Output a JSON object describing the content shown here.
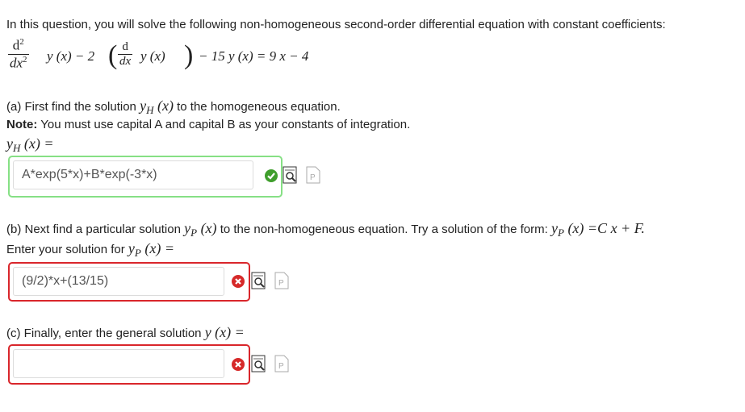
{
  "intro": "In this question, you will solve the following non-homogeneous second-order differential equation with constant coefficients:",
  "equation": {
    "d2": "d",
    "d2sup": "2",
    "dx2": "dx",
    "dx2sup": "2",
    "y1": "y (x) − 2",
    "d": "d",
    "dx": "dx",
    "y2": "y (x)",
    "rest": "− 15 y (x) = 9 x − 4"
  },
  "part_a": {
    "prompt_before": "(a) First find the solution ",
    "prompt_math": "y",
    "prompt_sub": "H",
    "prompt_arg": " (x)",
    "prompt_after": " to the homogeneous equation.",
    "note_label": "Note:",
    "note_text": " You must use capital A and capital B as your constants of integration.",
    "answer_label_y": "y",
    "answer_label_sub": "H",
    "answer_label_rest": " (x) =",
    "value": "A*exp(5*x)+B*exp(-3*x)",
    "status": "correct"
  },
  "part_b": {
    "prompt_before": "(b) Next find a particular solution ",
    "prompt_math": "y",
    "prompt_sub": "P",
    "prompt_arg": " (x)",
    "prompt_after": " to the non-homogeneous equation. Try a solution of the form: ",
    "form_y": "y",
    "form_sub": "P",
    "form_rest": " (x) =C x + F.",
    "enter_text": "Enter your solution for ",
    "enter_y": "y",
    "enter_sub": "P",
    "enter_rest": " (x) =",
    "value": "(9/2)*x+(13/15)",
    "status": "incorrect"
  },
  "part_c": {
    "prompt": "(c) Finally, enter the general solution ",
    "prompt_math": "y (x) =",
    "value": "",
    "status": "incorrect"
  },
  "colors": {
    "correct_border": "#86e085",
    "incorrect_border": "#d9262b",
    "check_green": "#3f9e2c",
    "cross_red": "#d62a2a"
  },
  "icons": [
    "check-icon",
    "cross-icon",
    "preview-icon",
    "help-document-icon"
  ]
}
